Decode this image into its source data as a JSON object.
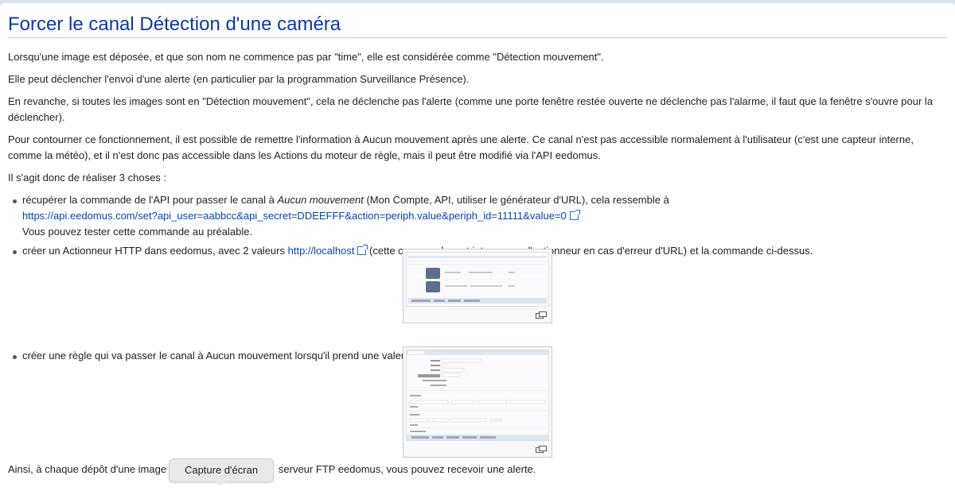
{
  "title": "Forcer le canal Détection d'une caméra",
  "paragraphs": [
    "Lorsqu'une image est déposée, et que son nom ne commence pas par \"time\", elle est considérée comme \"Détection mouvement\".",
    "Elle peut déclencher l'envoi d'une alerte (en particulier par la programmation Surveillance Présence).",
    "En revanche, si toutes les images sont en \"Détection mouvement\", cela ne déclenche pas l'alerte (comme une porte fenêtre restée ouverte ne déclenche pas l'alarme, il faut que la fenêtre s'ouvre pour la déclencher).",
    "Pour contourner ce fonctionnement, il est possible de remettre l'information à Aucun mouvement après une alerte. Ce canal n'est pas accessible normalement à l'utilisateur (c'est une capteur interne, comme la météo), et il n'est donc pas accessible dans les Actions du moteur de règle, mais il peut être modifié via l'API eedomus.",
    "Il s'agit donc de réaliser 3 choses :"
  ],
  "list": {
    "item1": {
      "text_before": "récupérer la commande de l'API pour passer le canal à ",
      "italic": "Aucun mouvement",
      "text_after": " (Mon Compte, API, utiliser le générateur d'URL), cela ressemble à",
      "link": "https://api.eedomus.com/set?api_user=aabbcc&api_secret=DDEEFFF&action=periph.value&periph_id=11111&value=0",
      "note": "Vous pouvez tester cette commande au préalable."
    },
    "item2": {
      "text_before": "créer un Actionneur HTTP dans eedomus, avec 2 valeurs ",
      "link": "http://localhost",
      "text_after": " (cette commande sert interrompre l'actionneur en cas d'erreur d'URL) et la commande ci-dessus."
    },
    "item3": {
      "text": "créer une règle qui va passer le canal à Aucun mouvement lorsqu'il prend une valeur différente."
    }
  },
  "closing_before": "Ainsi, à chaque dépôt d'une image p",
  "closing_after": "serveur FTP eedomus, vous pouvez recevoir une alerte.",
  "tooltip": "Capture d'écran",
  "colors": {
    "title": "#0b3aa3",
    "link": "#0645ad",
    "background": "#d8e3ef"
  }
}
